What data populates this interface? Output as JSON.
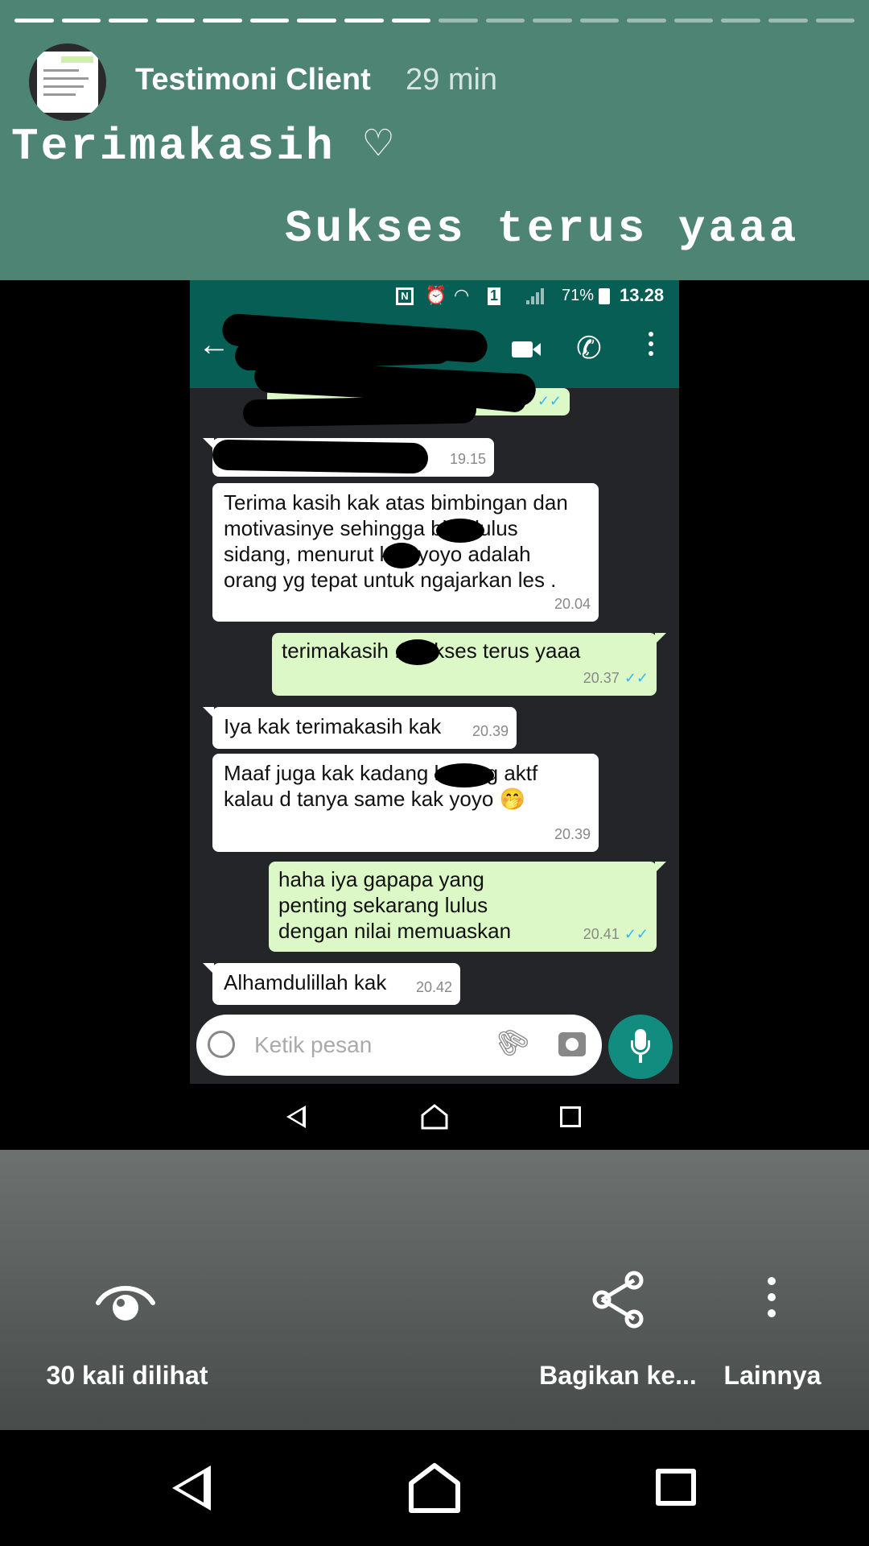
{
  "story": {
    "title": "Testimoni Client",
    "time": "29 min",
    "caption_line1": "Terimakasih ♡",
    "caption_line2": "Sukses terus yaaa",
    "progress_total_segments": 18,
    "progress_viewed_segments": 9
  },
  "chat_screenshot": {
    "status_bar": {
      "battery": "71%",
      "time": "13.28"
    },
    "messages": [
      {
        "dir": "out",
        "text": "",
        "time": "",
        "redacted": true
      },
      {
        "dir": "in",
        "text": "",
        "time": "19.15",
        "redacted": true
      },
      {
        "dir": "in",
        "text": "Terima kasih kak atas bimbingan dan motivasinye sehingga       bise lulus sidang, menurut       kak yoyo adalah orang yg tepat untuk ngajarkan les .",
        "time": "20.04"
      },
      {
        "dir": "out",
        "text": "terimakasih       .. sukses terus yaaa",
        "time": "20.37"
      },
      {
        "dir": "in",
        "text": "Iya kak terimakasih kak",
        "time": "20.39"
      },
      {
        "dir": "in",
        "text": "Maaf juga kak kadang        kurang aktf kalau d tanya same kak yoyo 🤭",
        "time": "20.39"
      },
      {
        "dir": "out",
        "text": "haha iya gapapa yang penting sekarang lulus dengan nilai memuaskan",
        "time": "20.41"
      },
      {
        "dir": "in",
        "text": "Alhamdulillah kak",
        "time": "20.42"
      }
    ],
    "input_placeholder": "Ketik pesan",
    "ticks": "✓✓"
  },
  "footer": {
    "views_label": "30 kali dilihat",
    "share_label": "Bagikan ke...",
    "more_label": "Lainnya"
  },
  "colors": {
    "story_header_bg": "#4e8474",
    "whatsapp_green": "#075e54",
    "bubble_out": "#dcf8c6",
    "tick_blue": "#34b7f1"
  }
}
